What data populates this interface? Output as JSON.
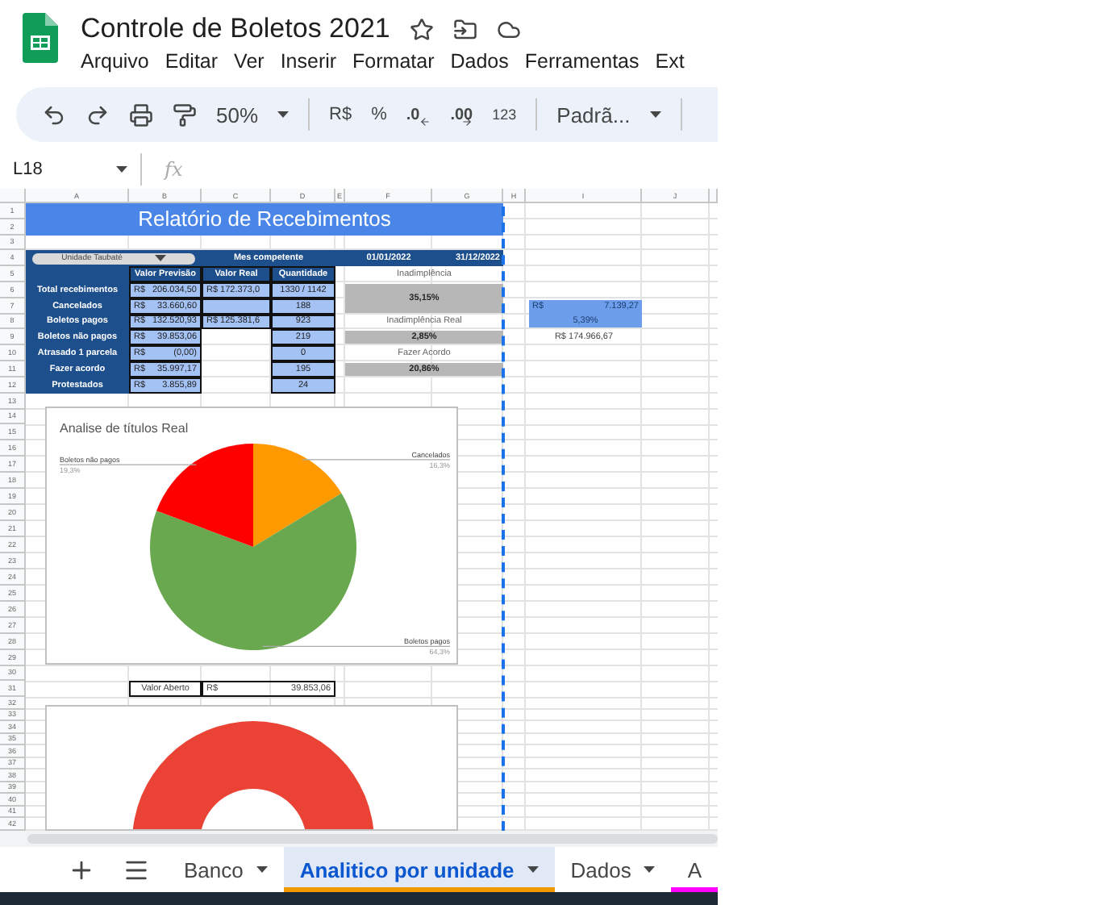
{
  "app": {
    "title": "Controle de Boletos 2021",
    "menu": [
      "Arquivo",
      "Editar",
      "Ver",
      "Inserir",
      "Formatar",
      "Dados",
      "Ferramentas",
      "Ext"
    ]
  },
  "toolbar": {
    "zoom": "50%",
    "currency": "R$",
    "percent": "%",
    "decrease_decimals": ".0",
    "increase_decimals": ".00",
    "number_format": "123",
    "font": "Padrã..."
  },
  "formula_bar": {
    "cell_ref": "L18",
    "function_label": "fx"
  },
  "sheet": {
    "columns": [
      "A",
      "B",
      "C",
      "D",
      "E",
      "F",
      "G",
      "H",
      "I",
      "J"
    ],
    "row_numbers": [
      "1",
      "2",
      "3",
      "4",
      "5",
      "6",
      "7",
      "8",
      "9",
      "10",
      "11",
      "12",
      "13",
      "14",
      "15",
      "16",
      "17",
      "18",
      "19",
      "20",
      "21",
      "22",
      "23",
      "24",
      "25",
      "26",
      "27",
      "28",
      "29",
      "30",
      "31",
      "32",
      "33",
      "34",
      "35",
      "36",
      "37",
      "38",
      "39",
      "40",
      "41",
      "42"
    ],
    "report_title": "Relatório de Recebimentos",
    "unit_dropdown": "Unidade Taubaté",
    "period": {
      "label": "Mes competente",
      "start": "01/01/2022",
      "end": "31/12/2022"
    },
    "table": {
      "columns": [
        "Valor Previsão",
        "Valor Real",
        "Quantidade"
      ],
      "rows": [
        {
          "label": "Total recebimentos",
          "forecast_currency": "R$",
          "forecast": "206.034,50",
          "real": "R$ 172.373,0",
          "real_shaded": true,
          "quantity": "1330 / 1142"
        },
        {
          "label": "Cancelados",
          "forecast_currency": "R$",
          "forecast": "33.660,60",
          "real_shaded": true,
          "quantity": "188"
        },
        {
          "label": "Boletos pagos",
          "forecast_currency": "R$",
          "forecast": "132.520,93",
          "real": "R$ 125.381,6",
          "real_shaded": true,
          "quantity": "923"
        },
        {
          "label": "Boletos não pagos",
          "forecast_currency": "R$",
          "forecast": "39.853,06",
          "real_shaded": false,
          "quantity": "219"
        },
        {
          "label": "Atrasado 1 parcela",
          "forecast_currency": "R$",
          "forecast": "(0,00)",
          "real_shaded": false,
          "quantity": "0"
        },
        {
          "label": "Fazer acordo",
          "forecast_currency": "R$",
          "forecast": "35.997,17",
          "real_shaded": false,
          "quantity": "195"
        },
        {
          "label": "Protestados",
          "forecast_currency": "R$",
          "forecast": "3.855,89",
          "real_shaded": false,
          "quantity": "24"
        }
      ]
    },
    "indicators": [
      {
        "kind": "caption",
        "text": "Inadimplência"
      },
      {
        "kind": "value",
        "text": "35,15%"
      },
      {
        "kind": "caption",
        "text": "Inadimplência Real"
      },
      {
        "kind": "value",
        "text": "2,85%"
      },
      {
        "kind": "caption",
        "text": "Fazer Acordo"
      },
      {
        "kind": "value",
        "text": "20,86%"
      }
    ],
    "side_summary": {
      "currency": "R$",
      "amount": "7.139,27",
      "percent": "5,39%",
      "total": "R$ 174.966,67"
    },
    "open_value": {
      "label": "Valor Aberto",
      "currency": "R$",
      "amount": "39.853,06"
    },
    "pie_chart": {
      "chart_data": {
        "type": "pie",
        "title": "Analise de títulos Real",
        "categories": [
          "Cancelados",
          "Boletos pagos",
          "Boletos não pagos"
        ],
        "values": [
          16.3,
          64.3,
          19.3
        ],
        "value_labels": [
          "16,3%",
          "64,3%",
          "19,3%"
        ]
      }
    }
  },
  "sheet_tabs": [
    {
      "label": "Banco",
      "selected": false
    },
    {
      "label": "Analitico por unidade",
      "selected": true,
      "color": "#f29900"
    },
    {
      "label": "Dados",
      "selected": false
    },
    {
      "label": "A",
      "selected": false,
      "color": "#ff00ff"
    }
  ]
}
